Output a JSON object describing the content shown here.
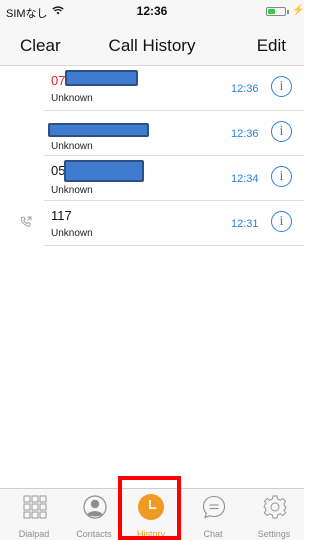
{
  "status_bar": {
    "carrier": "SIMなし",
    "time": "12:36",
    "battery_color": "#2fd13b"
  },
  "nav": {
    "left_label": "Clear",
    "title": "Call History",
    "right_label": "Edit"
  },
  "calls": [
    {
      "number": "07",
      "label": "Unknown",
      "time": "12:36",
      "missed": true,
      "number_redacted": true,
      "outgoing_icon": ""
    },
    {
      "number": "",
      "label": "Unknown",
      "time": "12:36",
      "missed": false,
      "number_redacted": true,
      "outgoing_icon": ""
    },
    {
      "number": "05",
      "label": "Unknown",
      "time": "12:34",
      "missed": false,
      "number_redacted": true,
      "outgoing_icon": ""
    },
    {
      "number": "117",
      "label": "Unknown",
      "time": "12:31",
      "missed": false,
      "number_redacted": false,
      "outgoing_icon": "outgoing-call-icon"
    }
  ],
  "info_glyph": "i",
  "tabs": [
    {
      "label": "Dialpad",
      "icon": "dialpad-icon",
      "active": false
    },
    {
      "label": "Contacts",
      "icon": "contacts-icon",
      "active": false
    },
    {
      "label": "History",
      "icon": "history-clock-icon",
      "active": true
    },
    {
      "label": "Chat",
      "icon": "chat-bubble-icon",
      "active": false
    },
    {
      "label": "Settings",
      "icon": "gear-icon",
      "active": false
    }
  ],
  "colors": {
    "accent_orange": "#f09a23",
    "link_blue": "#2a7ee8",
    "missed_red": "#e2231a",
    "highlight_red": "#ff0000"
  }
}
